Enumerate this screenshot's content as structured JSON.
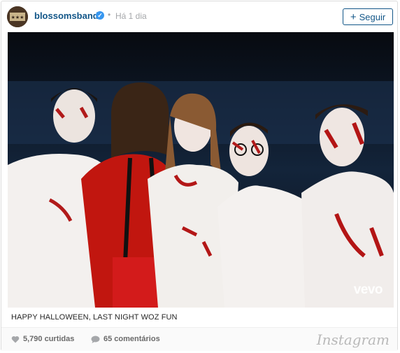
{
  "header": {
    "username": "blossomsband",
    "time": "Há 1 dia",
    "follow_label": "Seguir"
  },
  "caption": "HAPPY HALLOWEEN, LAST NIGHT WOZ FUN",
  "photo": {
    "watermark": "vevo"
  },
  "footer": {
    "likes": "5,790 curtidas",
    "comments": "65 comentários",
    "brand": "Instagram"
  },
  "colors": {
    "username": "#125688",
    "verified": "#3897f0",
    "muted": "#a5a7aa"
  },
  "icons": [
    "verified-badge-icon",
    "plus-icon",
    "heart-icon",
    "comment-bubble-icon"
  ]
}
